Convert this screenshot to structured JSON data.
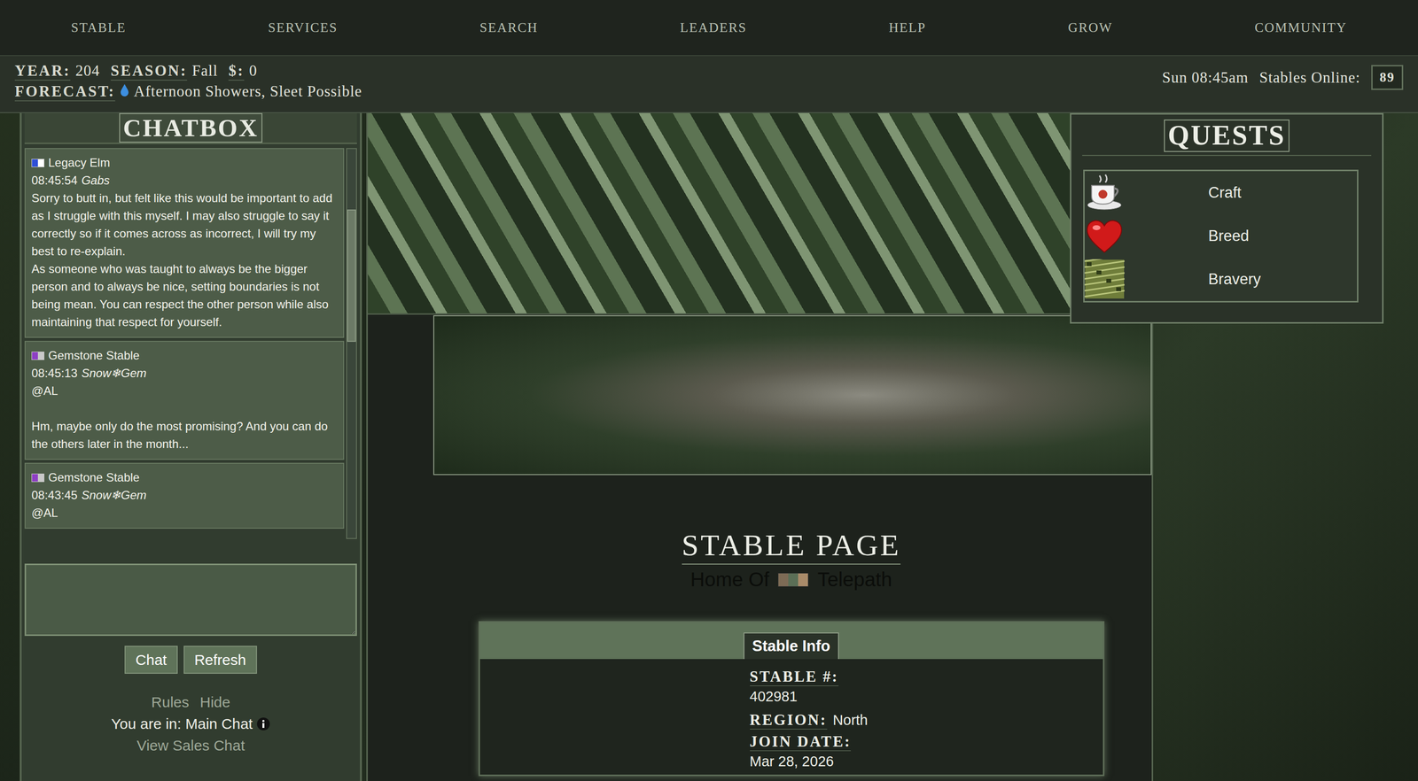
{
  "nav": [
    "STABLE",
    "SERVICES",
    "SEARCH",
    "LEADERS",
    "HELP",
    "GROW",
    "COMMUNITY"
  ],
  "info_bar": {
    "stats": [
      {
        "label": "YEAR:",
        "value": "204"
      },
      {
        "label": "SEASON:",
        "value": "Fall"
      },
      {
        "label": "$:",
        "value": "0"
      }
    ],
    "forecast": {
      "label": "FORECAST:",
      "value": "Afternoon Showers, Sleet Possible"
    },
    "time": "Sun 08:45am",
    "online_label": "Stables Online:",
    "online_count": "89"
  },
  "chatbox": {
    "title": "CHATBOX",
    "scroll": {
      "position": 0.155,
      "size": 0.34
    },
    "messages": [
      {
        "stable": "Legacy Elm",
        "colors": [
          "#2f4fd6",
          "#ffffff"
        ],
        "time": "08:45:54",
        "user": "Gabs",
        "lines": [
          "Sorry to butt in, but felt like this would be important to add as I struggle with this myself. I may also struggle to say it correctly so if it comes across as incorrect, I will try my best to re-explain.",
          "As someone who was taught to always be the bigger person and to always be nice, setting boundaries is not being mean. You can respect the other person while also maintaining that respect for yourself."
        ]
      },
      {
        "stable": "Gemstone Stable",
        "colors": [
          "#8e3fc4",
          "#c9c9c9"
        ],
        "time": "08:45:13",
        "user": "Snow❄Gem",
        "lines": [
          "@AL",
          "",
          "Hm, maybe only do the most promising? And you can do the others later in the month..."
        ]
      },
      {
        "stable": "Gemstone Stable",
        "colors": [
          "#8e3fc4",
          "#c9c9c9"
        ],
        "time": "08:43:45",
        "user": "Snow❄Gem",
        "lines": [
          "@AL"
        ]
      }
    ],
    "input_value": "",
    "buttons": [
      "Chat",
      "Refresh"
    ],
    "links": [
      "Rules",
      "Hide"
    ],
    "room_label": "You are in: Main Chat",
    "sales_link": "View Sales Chat"
  },
  "quests": {
    "title": "QUESTS",
    "items": [
      {
        "label": "Craft",
        "kind": "cup"
      },
      {
        "label": "Breed",
        "kind": "heart"
      },
      {
        "label": "Bravery",
        "kind": "tile"
      }
    ]
  },
  "page": {
    "title": "STABLE PAGE",
    "home_prefix": "Home Of",
    "stable_name": "Telepath",
    "swatch": [
      "#7d6b55",
      "#5b6f56",
      "#a98b69"
    ]
  },
  "stable_info": {
    "tab": "Stable Info",
    "fields": [
      {
        "label": "STABLE #:",
        "value": "402981",
        "kind": "stacked"
      },
      {
        "label": "REGION:",
        "value": "North",
        "kind": "inline"
      },
      {
        "label": "JOIN DATE:",
        "value": "Mar 28, 2026",
        "kind": "inline"
      }
    ]
  }
}
